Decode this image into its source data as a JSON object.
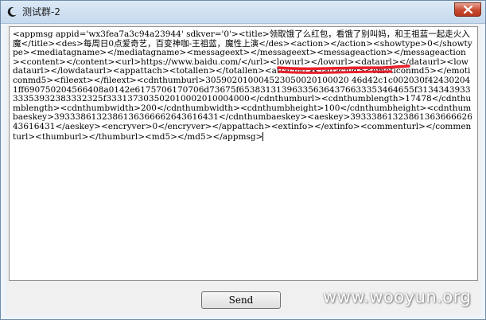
{
  "window": {
    "title": "测试群-2"
  },
  "message": {
    "body": "<appmsg appid='wx3fea7a3c94a23944' sdkver='0'><title>领取饿了么红包，看饿了别叫妈，和王祖蓝一起走火入魔</title><des>每周日0点爱奇艺，百变神咖-王祖蓝，魔性上演</des><action></action><showtype>0</showtype><mediatagname></mediatagname><messageext></messageext><messageaction></messageaction><content></content><url>https://www.baidu.com/</url><lowurl></lowurl><dataurl></dataurl><lowdataurl></lowdataurl><appattach><totallen></totallen><attachid></attachid><emoticonmd5></emoticonmd5><fileext></fileext><cdnthumburl>305902010004523050020100020 46d42c1c002030f424302041ff690750204566408a0142e6175706170706d73675f653831313963356364376633353464655f313434393333353932383332325f333137303502010002010004000</cdnthumburl><cdnthumblength>17478</cdnthumblength><cdnthumbwidth>200</cdnthumbwidth><cdnthumbheight>100</cdnthumbheight><cdnthumbaeskey>3933386132386136366662643616431</cdnthumbaeskey><aeskey>3933386132386136366662643616431</aeskey><encryver>0</encryver></appattach><extinfo></extinfo><commenturl></commenturl><thumburl></thumburl><md5></md5></appmsg>"
  },
  "buttons": {
    "send_label": "Send"
  },
  "watermark": {
    "text": "www.wooyun.org"
  },
  "colors": {
    "annotation_red": "#e8202a",
    "close_red": "#c74a2e"
  }
}
